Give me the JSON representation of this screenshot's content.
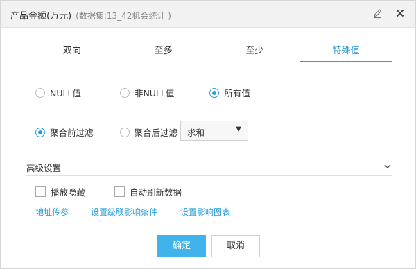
{
  "dialog": {
    "title": "产品金额(万元)",
    "subtitle": "(数据集:13_42机会统计 )"
  },
  "title_icons": [
    "edit-icon",
    "close-icon"
  ],
  "tabs": [
    {
      "label": "双向",
      "active": false
    },
    {
      "label": "至多",
      "active": false
    },
    {
      "label": "至少",
      "active": false
    },
    {
      "label": "特殊值",
      "active": true
    }
  ],
  "null_filter": {
    "options": [
      {
        "label": "NULL值",
        "checked": false
      },
      {
        "label": "非NULL值",
        "checked": false
      },
      {
        "label": "所有值",
        "checked": true
      }
    ]
  },
  "aggregation": {
    "options": [
      {
        "label": "聚合前过滤",
        "checked": true
      },
      {
        "label": "聚合后过滤",
        "checked": false
      }
    ],
    "select_value": "求和",
    "select_arrow": "▼"
  },
  "advanced": {
    "label": "高级设置",
    "checkboxes": [
      {
        "label": "播放隐藏",
        "checked": false
      },
      {
        "label": "自动刷新数据",
        "checked": false
      }
    ],
    "links": [
      "地址传参",
      "设置级联影响条件",
      "设置影响图表"
    ]
  },
  "buttons": {
    "ok": "确定",
    "cancel": "取消"
  },
  "colors": {
    "accent": "#2a9fd6",
    "primary_button": "#40b4ea",
    "titlebar_bg": "#f2f2f2"
  }
}
